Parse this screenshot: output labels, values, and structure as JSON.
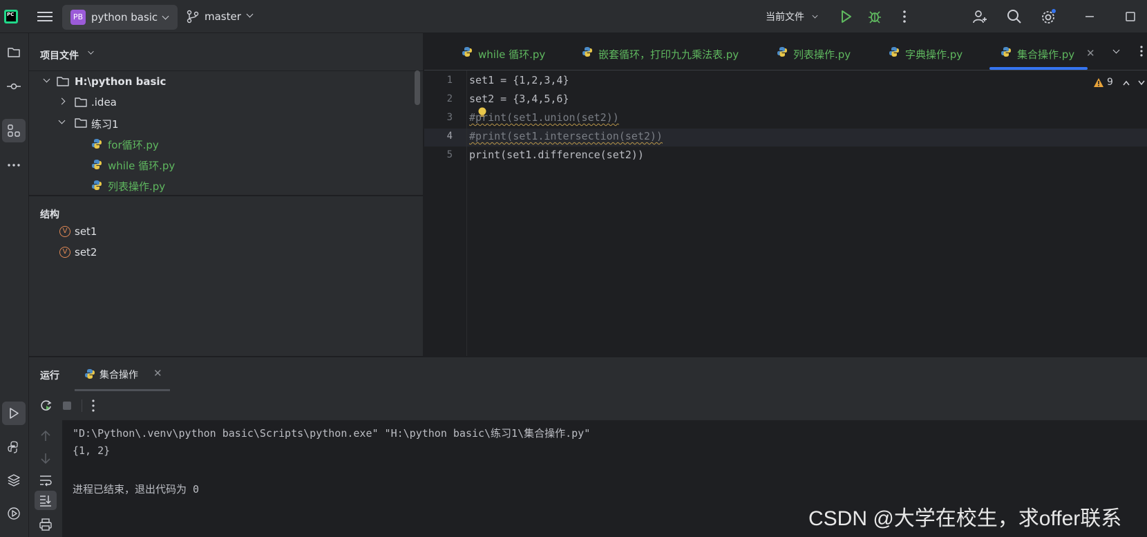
{
  "titlebar": {
    "project_badge": "PB",
    "project_name": "python basic",
    "branch": "master",
    "run_config": "当前文件"
  },
  "project_panel": {
    "title": "项目文件",
    "tree": [
      {
        "label": "H:\\python basic",
        "kind": "folder"
      },
      {
        "label": ".idea",
        "kind": "folder"
      },
      {
        "label": "练习1",
        "kind": "folder"
      },
      {
        "label": "for循环.py",
        "kind": "python-file"
      },
      {
        "label": "while 循环.py",
        "kind": "python-file"
      },
      {
        "label": "列表操作.py",
        "kind": "python-file"
      }
    ]
  },
  "structure_panel": {
    "title": "结构",
    "items": [
      {
        "badge": "V",
        "label": "set1"
      },
      {
        "badge": "V",
        "label": "set2"
      }
    ]
  },
  "editor_tabs": [
    {
      "label": "while 循环.py"
    },
    {
      "label": "嵌套循环，打印九九乘法表.py"
    },
    {
      "label": "列表操作.py"
    },
    {
      "label": "字典操作.py"
    },
    {
      "label": "集合操作.py",
      "active": true
    }
  ],
  "editor": {
    "line_numbers": [
      "1",
      "2",
      "3",
      "4",
      "5"
    ],
    "current_line": 4,
    "inspection_warnings": "9",
    "code": [
      "set1 = {1,2,3,4}",
      "set2 = {3,4,5,6}",
      "#print(set1.union(set2))",
      "#print(set1.intersection(set2))",
      "print(set1.difference(set2))"
    ]
  },
  "run_window": {
    "title": "运行",
    "tab_label": "集合操作",
    "console": [
      "\"D:\\Python\\.venv\\python basic\\Scripts\\python.exe\" \"H:\\python basic\\练习1\\集合操作.py\"",
      "{1, 2}",
      "",
      "进程已结束，退出代码为 0"
    ]
  },
  "watermark": "CSDN @大学在校生，求offer联系",
  "colors": {
    "accent": "#3574f0",
    "file_green": "#5fb85f",
    "number": "#2aacb8",
    "comment": "#7a7e85",
    "builtin": "#8888c6",
    "project_badge": "#9b5bd8"
  }
}
